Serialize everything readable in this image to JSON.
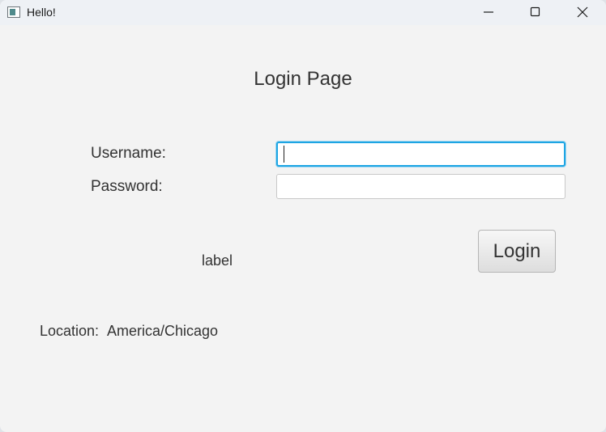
{
  "window": {
    "title": "Hello!",
    "controls": [
      "minimize-icon",
      "maximize-icon",
      "close-icon"
    ]
  },
  "login": {
    "heading": "Login Page",
    "username_label": "Username:",
    "username_value": "",
    "password_label": "Password:",
    "password_value": "",
    "button_label": "Login",
    "status_label": "label"
  },
  "location": {
    "label": "Location:",
    "value": "America/Chicago"
  },
  "colors": {
    "window_background": "#f3f3f3",
    "titlebar_background": "#eef1f5",
    "focus_border": "#1ea5e3"
  }
}
